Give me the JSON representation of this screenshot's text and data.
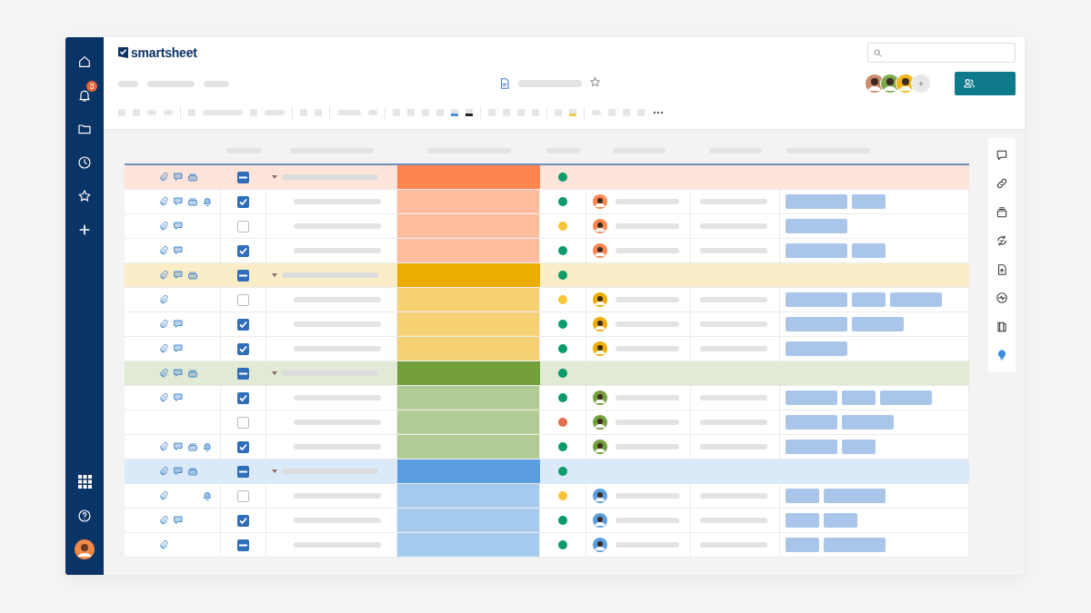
{
  "sidebar": {
    "notifications_badge": "3"
  },
  "header": {
    "logo": "smartsheet"
  },
  "rail": [
    {
      "selected": false
    },
    {
      "selected": false
    },
    {
      "selected": false
    },
    {
      "selected": false
    },
    {
      "selected": false
    },
    {
      "selected": false
    },
    {
      "selected": false
    },
    {
      "selected": true
    }
  ],
  "groups": [
    {
      "color": "#fd8550",
      "expanded": true,
      "checked": true,
      "partial": true,
      "attachment": true,
      "comment": true,
      "proof": true,
      "reminder": false,
      "status": {
        "color": "#0f9a6a"
      },
      "rows": [
        {
          "attachment": true,
          "comment": true,
          "proof": true,
          "reminder": true,
          "checked": true,
          "partial": false,
          "status": {
            "color": "#0f9a6a"
          },
          "tags": [
            {
              "kind": "long"
            },
            {
              "kind": "short"
            }
          ]
        },
        {
          "attachment": true,
          "comment": true,
          "proof": false,
          "reminder": false,
          "checked": false,
          "status": {
            "color": "#f9c43a"
          },
          "tags": [
            {
              "kind": "long"
            }
          ]
        },
        {
          "attachment": true,
          "comment": true,
          "proof": false,
          "reminder": false,
          "checked": true,
          "partial": false,
          "status": {
            "color": "#0f9a6a"
          },
          "tags": [
            {
              "kind": "long"
            },
            {
              "kind": "short"
            }
          ]
        }
      ]
    },
    {
      "color": "#edac00",
      "expanded": true,
      "checked": true,
      "partial": true,
      "attachment": true,
      "comment": true,
      "proof": true,
      "reminder": false,
      "status": {
        "color": "#0f9a6a"
      },
      "rows": [
        {
          "attachment": true,
          "comment": false,
          "proof": false,
          "reminder": false,
          "checked": false,
          "status": {
            "color": "#f9c43a"
          },
          "tags": [
            {
              "kind": "long"
            },
            {
              "kind": "short"
            },
            {
              "kind": "medium"
            }
          ]
        },
        {
          "attachment": true,
          "comment": true,
          "proof": false,
          "reminder": false,
          "checked": true,
          "partial": false,
          "status": {
            "color": "#0f9a6a"
          },
          "tags": [
            {
              "kind": "long"
            },
            {
              "kind": "medium"
            }
          ]
        },
        {
          "attachment": true,
          "comment": true,
          "proof": false,
          "reminder": false,
          "checked": true,
          "partial": false,
          "status": {
            "color": "#0f9a6a"
          },
          "tags": [
            {
              "kind": "long"
            }
          ]
        }
      ]
    },
    {
      "color": "#73a03c",
      "expanded": true,
      "checked": true,
      "partial": true,
      "attachment": true,
      "comment": true,
      "proof": true,
      "reminder": false,
      "status": {
        "color": "#0f9a6a"
      },
      "rows": [
        {
          "attachment": true,
          "comment": true,
          "proof": false,
          "reminder": false,
          "checked": true,
          "partial": false,
          "status": {
            "color": "#0f9a6a"
          },
          "tags": [
            {
              "kind": "medium"
            },
            {
              "kind": "short"
            },
            {
              "kind": "medium"
            }
          ]
        },
        {
          "attachment": false,
          "comment": false,
          "proof": false,
          "reminder": false,
          "checked": false,
          "status": {
            "color": "#e2704e"
          },
          "tags": [
            {
              "kind": "medium"
            },
            {
              "kind": "medium"
            }
          ]
        },
        {
          "attachment": true,
          "comment": true,
          "proof": true,
          "reminder": true,
          "checked": true,
          "partial": false,
          "status": {
            "color": "#0f9a6a"
          },
          "tags": [
            {
              "kind": "medium"
            },
            {
              "kind": "short"
            }
          ]
        }
      ]
    },
    {
      "color": "#5a9ee0",
      "expanded": true,
      "checked": true,
      "partial": true,
      "attachment": true,
      "comment": true,
      "proof": true,
      "reminder": false,
      "status": {
        "color": "#0f9a6a"
      },
      "rows": [
        {
          "attachment": true,
          "comment": false,
          "proof": false,
          "reminder": true,
          "checked": false,
          "status": {
            "color": "#f9c43a"
          },
          "tags": [
            {
              "kind": "short"
            },
            {
              "kind": "long"
            }
          ]
        },
        {
          "attachment": true,
          "comment": true,
          "proof": false,
          "reminder": false,
          "checked": true,
          "partial": false,
          "status": {
            "color": "#0f9a6a"
          },
          "tags": [
            {
              "kind": "short"
            },
            {
              "kind": "short"
            }
          ]
        },
        {
          "attachment": true,
          "comment": false,
          "proof": false,
          "reminder": false,
          "checked": true,
          "partial": true,
          "status": {
            "color": "#0f9a6a"
          },
          "tags": [
            {
              "kind": "short"
            },
            {
              "kind": "long"
            }
          ]
        }
      ]
    }
  ]
}
